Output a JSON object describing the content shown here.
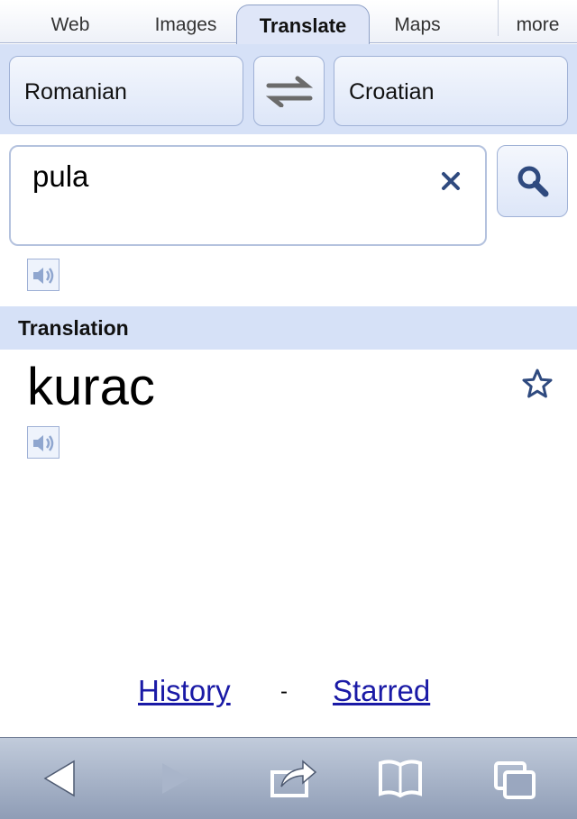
{
  "tabs": {
    "web": "Web",
    "images": "Images",
    "translate": "Translate",
    "maps": "Maps",
    "more": "more"
  },
  "languages": {
    "source": "Romanian",
    "target": "Croatian"
  },
  "input": {
    "value": "pula"
  },
  "translation": {
    "header": "Translation",
    "result": "kurac"
  },
  "footer": {
    "history": "History",
    "separator": "-",
    "starred": "Starred"
  },
  "icons": {
    "swap": "swap-arrows-icon",
    "clear": "close-icon",
    "search": "search-icon",
    "speaker": "speaker-icon",
    "star": "star-icon",
    "back": "back-arrow-icon",
    "forward": "forward-arrow-icon",
    "share": "share-icon",
    "bookmarks": "bookmarks-icon",
    "tabs": "tabs-icon"
  },
  "colors": {
    "accent_bar": "#d6e1f7",
    "link": "#1a1aa6",
    "icon_blue": "#2f4a7f"
  }
}
